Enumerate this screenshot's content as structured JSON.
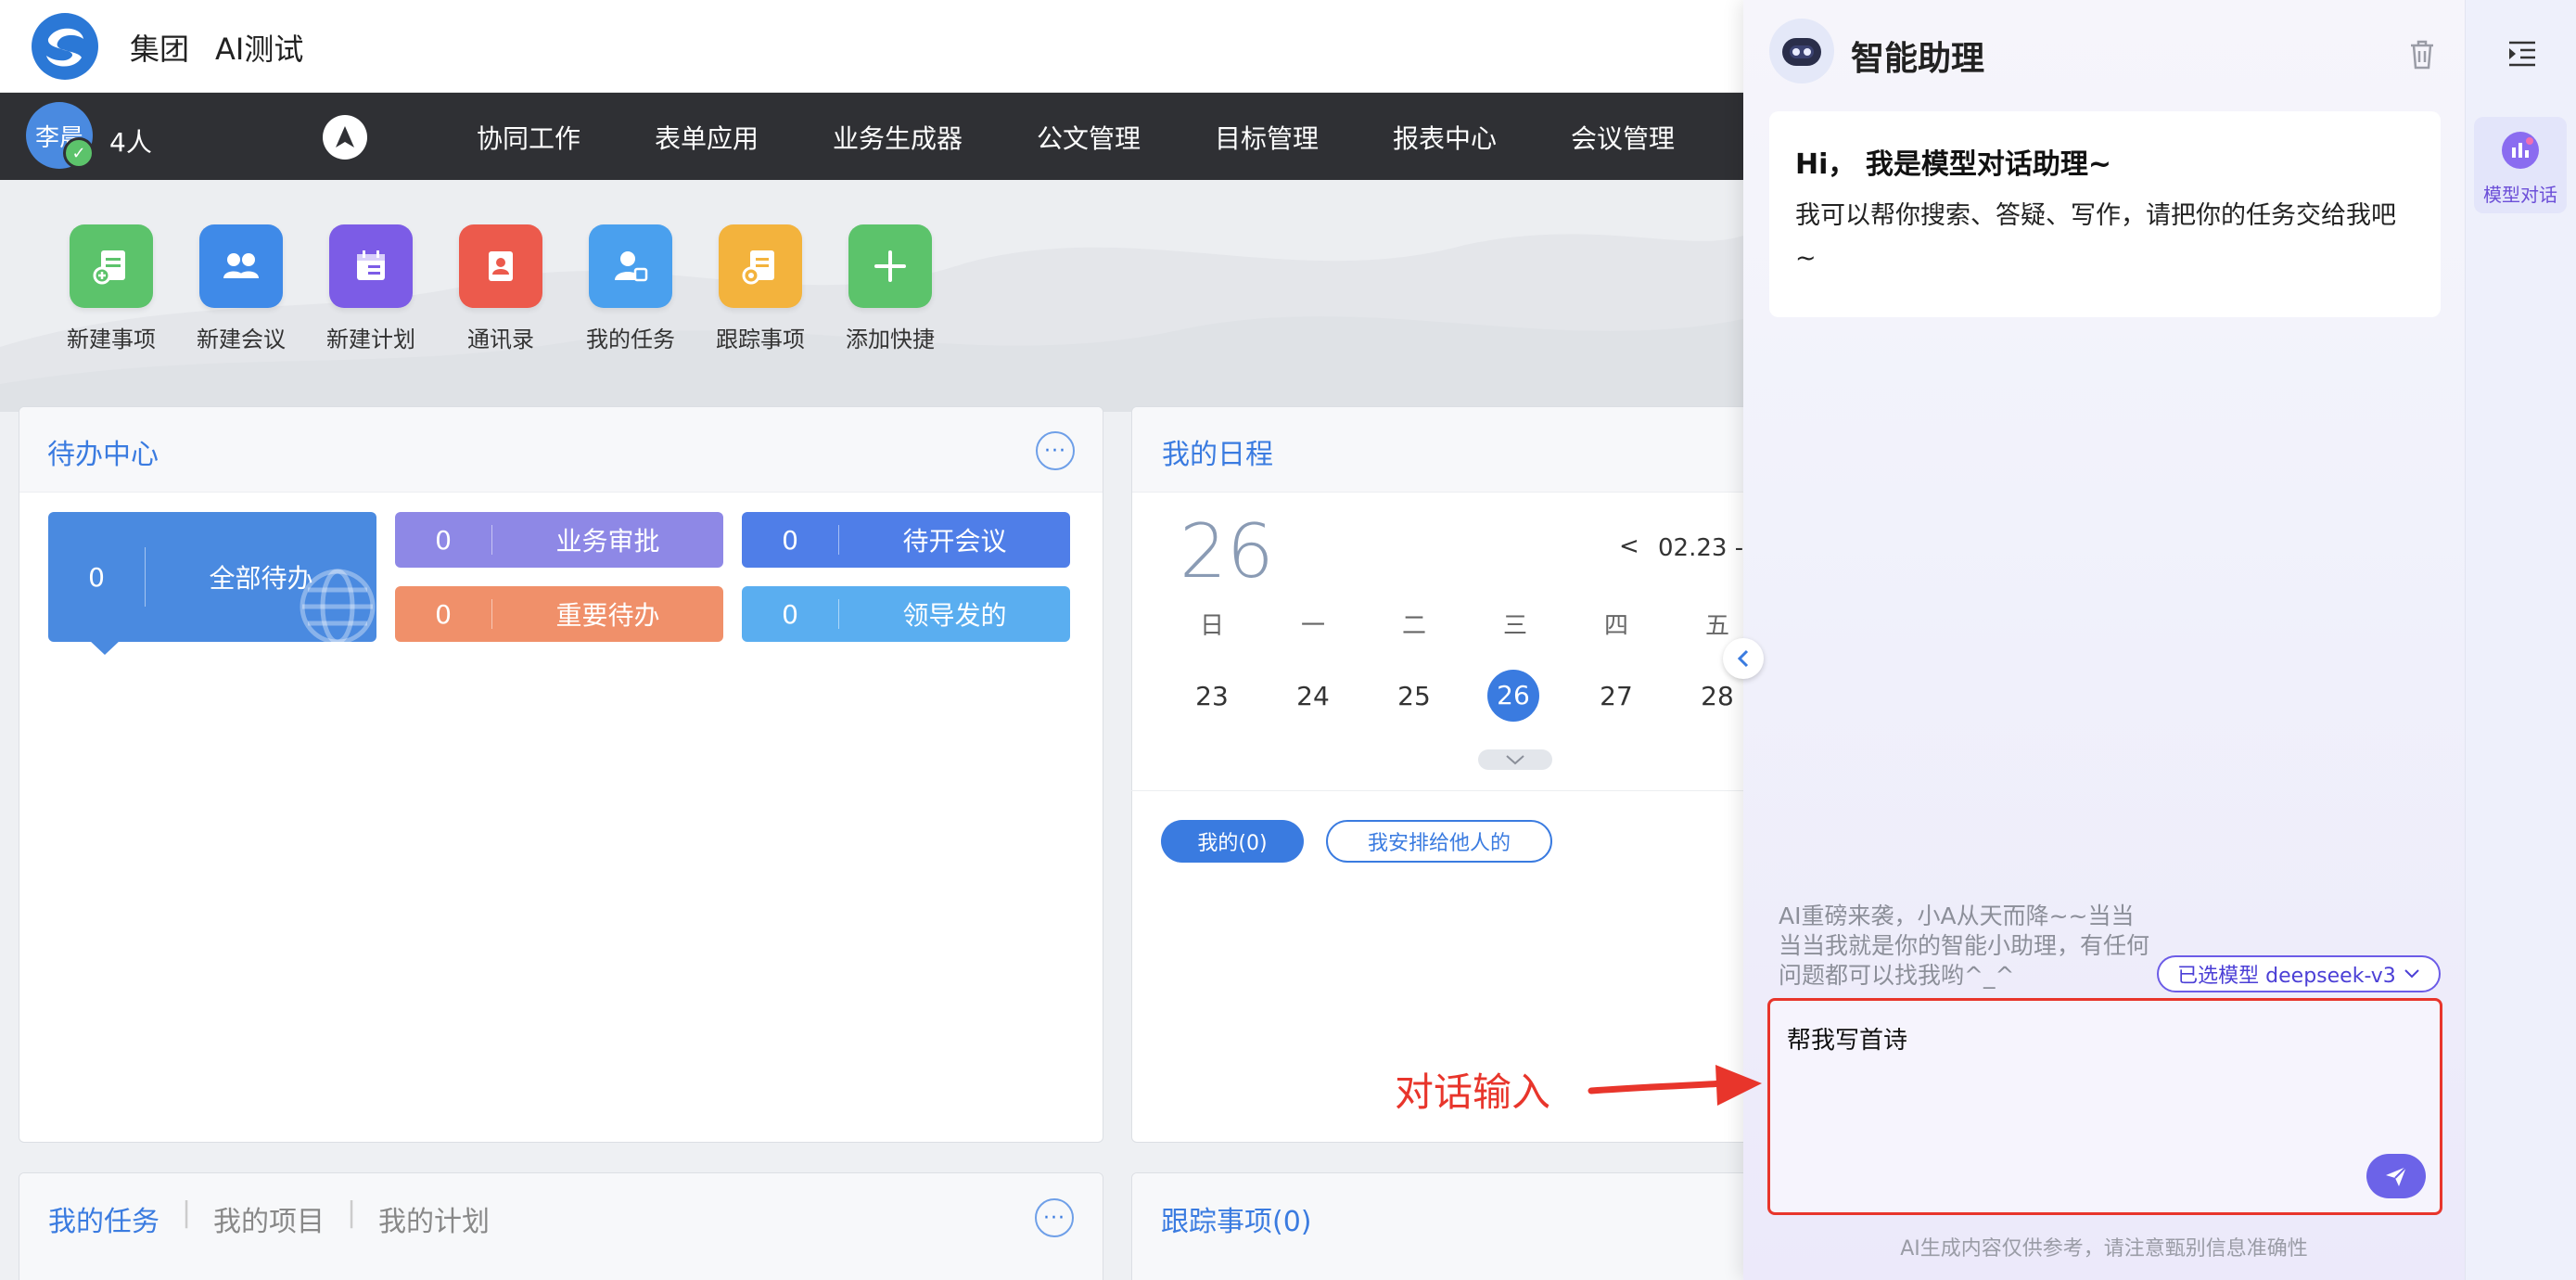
{
  "header": {
    "company": "集团",
    "module": "AI测试"
  },
  "nav": {
    "avatar_text": "李晨",
    "people_count": "4人",
    "items": [
      "协同工作",
      "表单应用",
      "业务生成器",
      "公文管理",
      "目标管理",
      "报表中心",
      "会议管理"
    ]
  },
  "quick_actions": [
    {
      "label": "新建事项",
      "color": "#5cc36b"
    },
    {
      "label": "新建会议",
      "color": "#3f8ae8"
    },
    {
      "label": "新建计划",
      "color": "#7c5ce6"
    },
    {
      "label": "通讯录",
      "color": "#ec5a4c"
    },
    {
      "label": "我的任务",
      "color": "#4aa0ee"
    },
    {
      "label": "跟踪事项",
      "color": "#f3b33d"
    },
    {
      "label": "添加快捷",
      "color": "#5cc36b"
    }
  ],
  "todo": {
    "title": "待办中心",
    "more": "···",
    "all": {
      "count": "0",
      "label": "全部待办"
    },
    "approval": {
      "count": "0",
      "label": "业务审批"
    },
    "meeting": {
      "count": "0",
      "label": "待开会议"
    },
    "important": {
      "count": "0",
      "label": "重要待办"
    },
    "leader": {
      "count": "0",
      "label": "领导发的"
    }
  },
  "schedule": {
    "title": "我的日程",
    "big_day": "26",
    "prev": "<",
    "range": "02.23 -",
    "weekdays": [
      "日",
      "一",
      "二",
      "三",
      "四",
      "五"
    ],
    "days": [
      "23",
      "24",
      "25",
      "26",
      "27",
      "28"
    ],
    "filters": {
      "mine": "我的(0)",
      "assigned": "我安排给他人的"
    }
  },
  "tasks": {
    "tabs": [
      "我的任务",
      "我的项目",
      "我的计划"
    ],
    "sep": "|",
    "more": "···"
  },
  "tracking": {
    "title": "跟踪事项(0)"
  },
  "assistant": {
    "title": "智能助理",
    "side_tab": "模型对话",
    "greeting_title": "Hi， 我是模型对话助理~",
    "greeting_body": "我可以帮你搜索、答疑、写作，请把你的任务交给我吧~",
    "tip": "AI重磅来袭，小A从天而降~~当当当当我就是你的智能小助理，有任何问题都可以找我哟^_^",
    "model_label": "已选模型 deepseek-v3",
    "input_value": "帮我写首诗",
    "disclaimer": "AI生成内容仅供参考，请注意甄别信息准确性"
  },
  "annotation": {
    "text": "对话输入"
  }
}
